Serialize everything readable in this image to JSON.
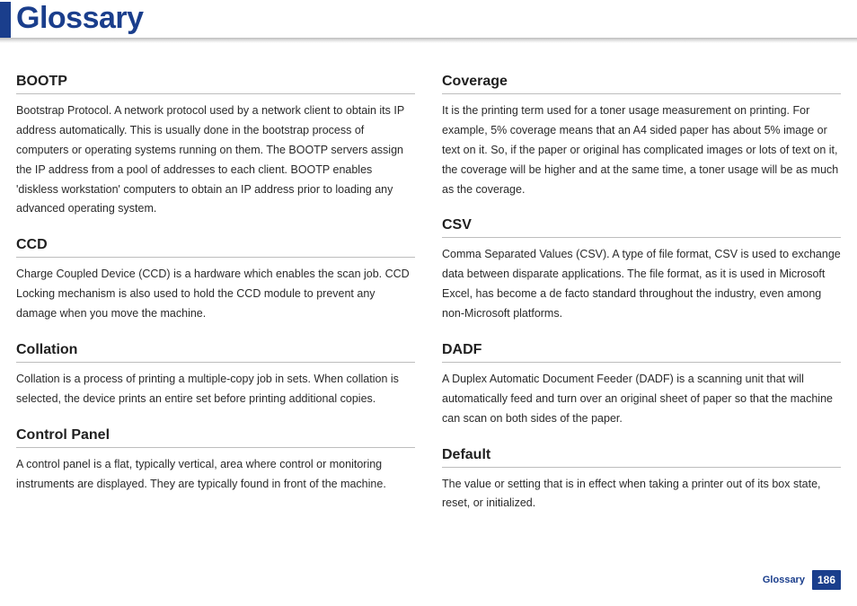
{
  "page_title": "Glossary",
  "footer": {
    "label": "Glossary",
    "page_number": "186"
  },
  "left": [
    {
      "term": "BOOTP",
      "def": "Bootstrap Protocol. A network protocol used by a network client to obtain its IP address automatically. This is usually done in the bootstrap process of computers or operating systems running on them. The BOOTP servers assign the IP address from a pool of addresses to each client. BOOTP enables 'diskless workstation' computers to obtain an IP address prior to loading any advanced operating system."
    },
    {
      "term": "CCD",
      "def": "Charge Coupled Device (CCD) is a hardware which enables the scan job. CCD Locking mechanism is also used to hold the CCD module to prevent any damage when you move the machine."
    },
    {
      "term": "Collation",
      "def": "Collation is a process of printing a multiple-copy job in sets. When collation is selected, the device prints an entire set before printing additional copies."
    },
    {
      "term": "Control Panel",
      "def": "A control panel is a flat, typically vertical, area where control or monitoring instruments are displayed. They are typically found in front of the machine."
    }
  ],
  "right": [
    {
      "term": "Coverage",
      "def": "It is the printing term used for a toner usage measurement on printing. For example, 5% coverage means that an A4 sided paper has about 5% image or text on it. So, if the paper or original has complicated images or lots of text on it, the coverage will be higher and at the same time, a toner usage will be as much as the coverage."
    },
    {
      "term": "CSV",
      "def": "Comma Separated Values (CSV). A type of file format, CSV is used to exchange data between disparate applications. The file format, as it is used in Microsoft Excel, has become a de facto standard throughout the industry, even among non-Microsoft platforms."
    },
    {
      "term": "DADF",
      "def": "A Duplex Automatic Document Feeder (DADF) is a scanning unit that will automatically feed and turn over an original sheet of paper so that the machine can scan on both sides of the paper."
    },
    {
      "term": "Default",
      "def": "The value or setting that is in effect when taking a printer out of its box state, reset, or initialized."
    }
  ]
}
